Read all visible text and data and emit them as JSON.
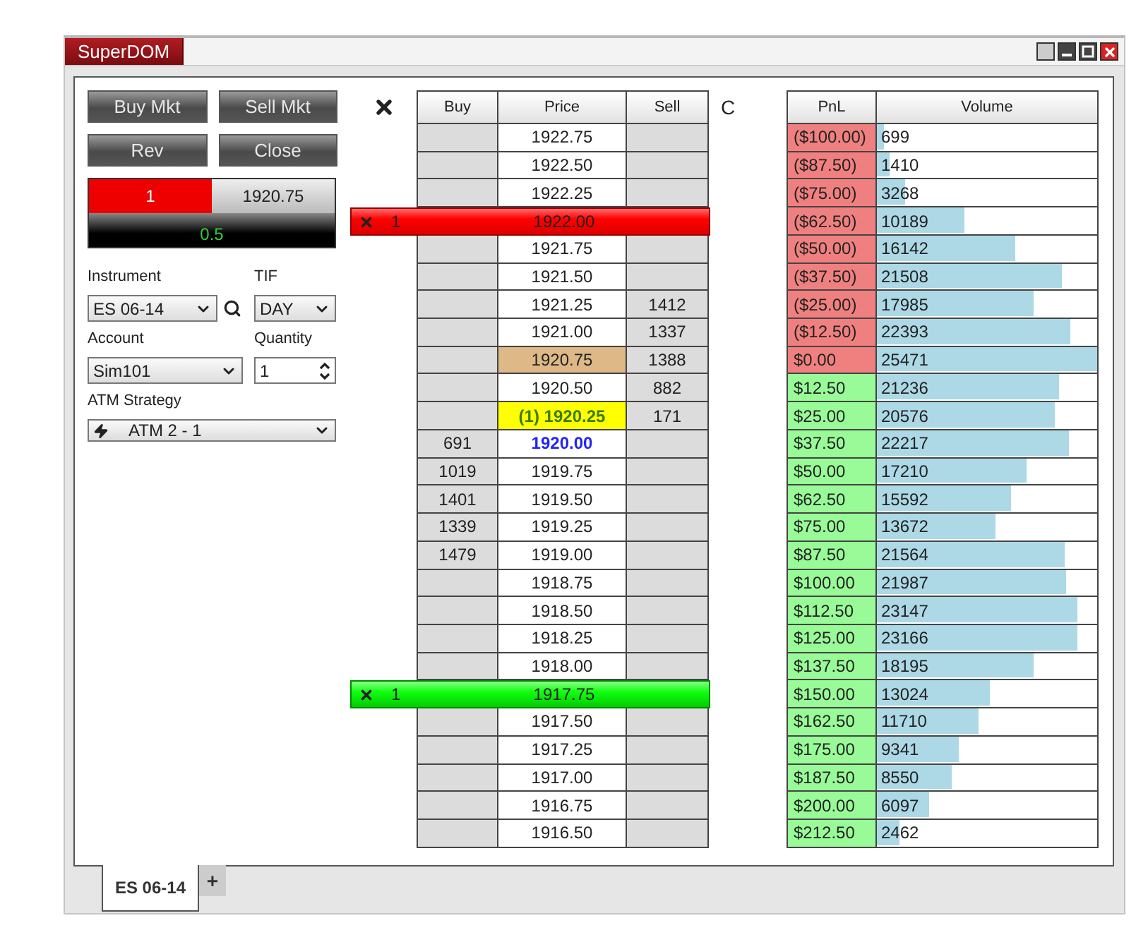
{
  "window": {
    "title": "SuperDOM"
  },
  "order_entry": {
    "buttons": [
      {
        "label": "Buy Mkt"
      },
      {
        "label": "Sell Mkt"
      },
      {
        "label": "Rev"
      },
      {
        "label": "Close"
      }
    ],
    "position": {
      "quantity": "1",
      "price": "1920.75",
      "pnl": "0.5"
    },
    "fields": [
      {
        "kind": "select",
        "label": "Instrument",
        "value": "ES 06-14",
        "search": true
      },
      {
        "kind": "select",
        "label": "TIF",
        "value": "DAY"
      },
      {
        "kind": "select",
        "label": "Account",
        "value": "Sim101"
      },
      {
        "kind": "spinner",
        "label": "Quantity",
        "value": "1"
      },
      {
        "kind": "strategy",
        "label": "ATM Strategy",
        "value": "ATM 2 - 1"
      }
    ]
  },
  "ladder": {
    "columns": [
      "Buy",
      "Price",
      "Sell"
    ],
    "center_label": "C",
    "stats_columns": [
      "PnL",
      "Volume"
    ],
    "rows": [
      {
        "price": "1922.75",
        "kind": "plain",
        "pnl": "($100.00)",
        "color": "#f08080",
        "volume": "699",
        "level": 0.03
      },
      {
        "price": "1922.50",
        "kind": "plain",
        "pnl": "($87.50)",
        "color": "#f08080",
        "volume": "1410",
        "level": 0.06
      },
      {
        "price": "1922.25",
        "kind": "plain",
        "pnl": "($75.00)",
        "color": "#f08080",
        "volume": "3268",
        "level": 0.13
      },
      {
        "price": "1922.00",
        "kind": "plain",
        "order": {
          "kind": "sell",
          "quantity": "1"
        },
        "pnl": "($62.50)",
        "color": "#f08080",
        "volume": "10189",
        "level": 0.4
      },
      {
        "price": "1921.75",
        "kind": "plain",
        "pnl": "($50.00)",
        "color": "#f08080",
        "volume": "16142",
        "level": 0.63
      },
      {
        "price": "1921.50",
        "kind": "plain",
        "pnl": "($37.50)",
        "color": "#f08080",
        "volume": "21508",
        "level": 0.84
      },
      {
        "price": "1921.25",
        "kind": "plain",
        "sell": "1412",
        "pnl": "($25.00)",
        "color": "#f08080",
        "volume": "17985",
        "level": 0.71
      },
      {
        "price": "1921.00",
        "kind": "plain",
        "sell": "1337",
        "pnl": "($12.50)",
        "color": "#f08080",
        "volume": "22393",
        "level": 0.88
      },
      {
        "price": "1920.75",
        "kind": "last",
        "sell": "1388",
        "pnl": "$0.00",
        "color": "#f08080",
        "volume": "25471",
        "level": 1
      },
      {
        "price": "1920.50",
        "kind": "plain",
        "sell": "882",
        "pnl": "$12.50",
        "color": "#98fb98",
        "volume": "21236",
        "level": 0.83
      },
      {
        "price": "(1) 1920.25",
        "kind": "position",
        "sell": "171",
        "pnl": "$25.00",
        "color": "#98fb98",
        "volume": "20576",
        "level": 0.81
      },
      {
        "price": "1920.00",
        "kind": "bid",
        "buy": "691",
        "pnl": "$37.50",
        "color": "#98fb98",
        "volume": "22217",
        "level": 0.87
      },
      {
        "price": "1919.75",
        "kind": "plain",
        "buy": "1019",
        "pnl": "$50.00",
        "color": "#98fb98",
        "volume": "17210",
        "level": 0.68
      },
      {
        "price": "1919.50",
        "kind": "plain",
        "buy": "1401",
        "pnl": "$62.50",
        "color": "#98fb98",
        "volume": "15592",
        "level": 0.61
      },
      {
        "price": "1919.25",
        "kind": "plain",
        "buy": "1339",
        "pnl": "$75.00",
        "color": "#98fb98",
        "volume": "13672",
        "level": 0.54
      },
      {
        "price": "1919.00",
        "kind": "plain",
        "buy": "1479",
        "pnl": "$87.50",
        "color": "#98fb98",
        "volume": "21564",
        "level": 0.85
      },
      {
        "price": "1918.75",
        "kind": "plain",
        "pnl": "$100.00",
        "color": "#98fb98",
        "volume": "21987",
        "level": 0.86
      },
      {
        "price": "1918.50",
        "kind": "plain",
        "pnl": "$112.50",
        "color": "#98fb98",
        "volume": "23147",
        "level": 0.91
      },
      {
        "price": "1918.25",
        "kind": "plain",
        "pnl": "$125.00",
        "color": "#98fb98",
        "volume": "23166",
        "level": 0.91
      },
      {
        "price": "1918.00",
        "kind": "plain",
        "pnl": "$137.50",
        "color": "#98fb98",
        "volume": "18195",
        "level": 0.71
      },
      {
        "price": "1917.75",
        "kind": "plain",
        "order": {
          "kind": "buy",
          "quantity": "1"
        },
        "pnl": "$150.00",
        "color": "#98fb98",
        "volume": "13024",
        "level": 0.51
      },
      {
        "price": "1917.50",
        "kind": "plain",
        "pnl": "$162.50",
        "color": "#98fb98",
        "volume": "11710",
        "level": 0.46
      },
      {
        "price": "1917.25",
        "kind": "plain",
        "pnl": "$175.00",
        "color": "#98fb98",
        "volume": "9341",
        "level": 0.37
      },
      {
        "price": "1917.00",
        "kind": "plain",
        "pnl": "$187.50",
        "color": "#98fb98",
        "volume": "8550",
        "level": 0.34
      },
      {
        "price": "1916.75",
        "kind": "plain",
        "pnl": "$200.00",
        "color": "#98fb98",
        "volume": "6097",
        "level": 0.24
      },
      {
        "price": "1916.50",
        "kind": "plain",
        "pnl": "$212.50",
        "color": "#98fb98",
        "volume": "2462",
        "level": 0.1
      }
    ]
  },
  "tabs": [
    {
      "label": "ES 06-14",
      "selected": true
    }
  ],
  "new_tab": "+"
}
